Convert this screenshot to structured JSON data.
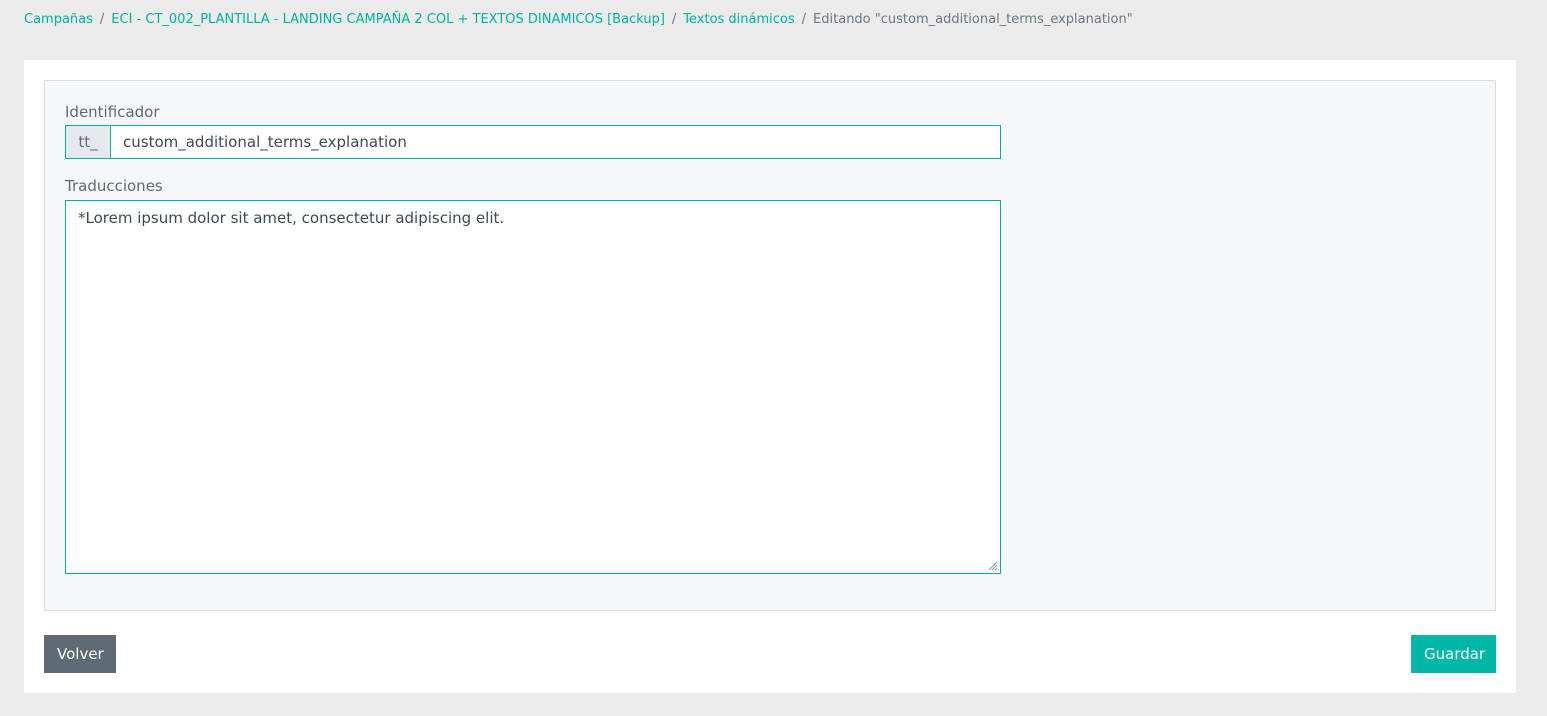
{
  "breadcrumb": {
    "items": [
      {
        "label": "Campañas"
      },
      {
        "label": "ECI - CT_002_PLANTILLA - LANDING CAMPAÑA 2 COL + TEXTOS DINAMICOS [Backup]"
      },
      {
        "label": "Textos dinámicos"
      }
    ],
    "separator": "/",
    "current": "Editando \"custom_additional_terms_explanation\""
  },
  "form": {
    "identifier_label": "Identificador",
    "identifier_prefix": "tt_",
    "identifier_value": "custom_additional_terms_explanation",
    "translations_label": "Traducciones",
    "translations_value": "*Lorem ipsum dolor sit amet, consectetur adipiscing elit."
  },
  "actions": {
    "back_label": "Volver",
    "save_label": "Guardar"
  },
  "colors": {
    "accent": "#00b3a1",
    "back_button": "#5e6b74",
    "background": "#ebebeb"
  }
}
